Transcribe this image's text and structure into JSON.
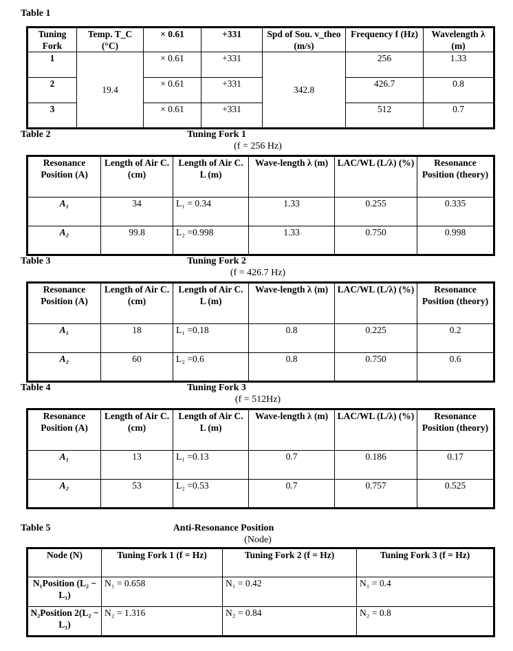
{
  "table1": {
    "label": "Table 1",
    "headers": [
      "Tuning Fork",
      "Temp. T_C (°C)",
      "× 0.61",
      "+331",
      "Spd of Sou. v_theo (m/s)",
      "Frequency f (Hz)",
      "Wavelength λ (m)"
    ],
    "rows": [
      {
        "fork": "1",
        "mult": "× 0.61",
        "add": "+331",
        "freq": "256",
        "wl": "1.33"
      },
      {
        "fork": "2",
        "mult": "× 0.61",
        "add": "+331",
        "freq": "426.7",
        "wl": "0.8"
      },
      {
        "fork": "3",
        "mult": "× 0.61",
        "add": "+331",
        "freq": "512",
        "wl": "0.7"
      }
    ],
    "temp": "19.4",
    "speed": "342.8"
  },
  "headers_res": [
    "Resonance Position (A)",
    "Length of Air C. (cm)",
    "Length of Air C. L (m)",
    "Wave-length λ (m)",
    "LAC/WL (L/λ) (%)",
    "Resonance Position (theory)"
  ],
  "table2": {
    "label": "Table 2",
    "title": "Tuning Fork 1",
    "freq": "(f = 256 Hz)",
    "rows": [
      [
        "A₁",
        "34",
        "L₁ = 0.34",
        "1.33",
        "0.255",
        "0.335"
      ],
      [
        "A₂",
        "99.8",
        "L₂ =0.998",
        "1.33",
        "0.750",
        "0.998"
      ]
    ]
  },
  "table3": {
    "label": "Table 3",
    "title": "Tuning Fork 2",
    "freq": "(f = 426.7 Hz)",
    "rows": [
      [
        "A₁",
        "18",
        "L₁ =0.18",
        "0.8",
        "0.225",
        "0.2"
      ],
      [
        "A₂",
        "60",
        "L₂ =0.6",
        "0.8",
        "0.750",
        "0.6"
      ]
    ]
  },
  "table4": {
    "label": "Table 4",
    "title": "Tuning Fork 3",
    "freq": "(f = 512Hz)",
    "rows": [
      [
        "A₁",
        "13",
        "L₁ =0.13",
        "0.7",
        "0.186",
        "0.17"
      ],
      [
        "A₂",
        "53",
        "L₂ =0.53",
        "0.7",
        "0.757",
        "0.525"
      ]
    ]
  },
  "table5": {
    "label": "Table 5",
    "title": "Anti-Resonance Position",
    "subtitle": "(Node)",
    "headers": [
      "Node (N)",
      "Tuning Fork 1 (f =    Hz)",
      "Tuning Fork 2 (f =    Hz)",
      "Tuning Fork 3 (f =    Hz)"
    ],
    "rows": [
      [
        "N₁Position (L₂ − L₁)",
        "N₁ = 0.658",
        "N₁ = 0.42",
        "N₁ = 0.4"
      ],
      [
        "N₂Position 2(L₂ − L₁)",
        "N₂ = 1.316",
        "N₂ = 0.84",
        "N₂ = 0.8"
      ]
    ]
  }
}
